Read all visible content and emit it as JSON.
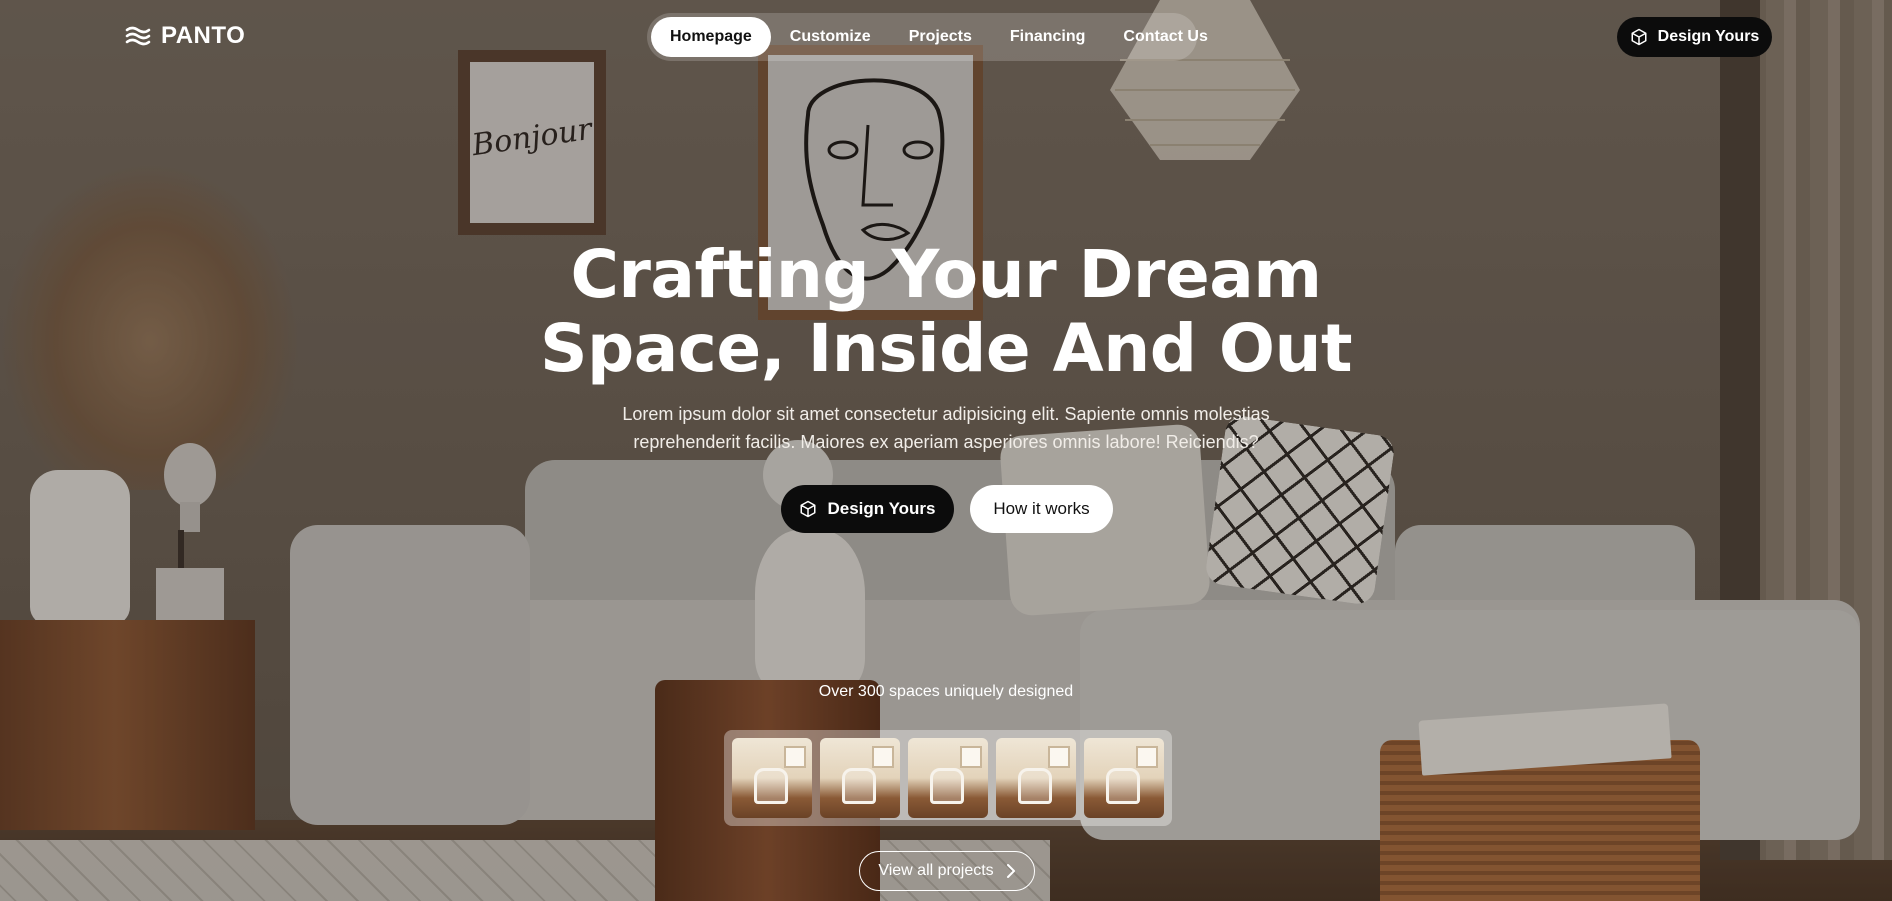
{
  "brand": {
    "name": "PANTO",
    "logo_icon": "waves-icon"
  },
  "nav": {
    "items": [
      {
        "label": "Homepage",
        "active": true
      },
      {
        "label": "Customize",
        "active": false
      },
      {
        "label": "Projects",
        "active": false
      },
      {
        "label": "Financing",
        "active": false
      },
      {
        "label": "Contact Us",
        "active": false
      }
    ],
    "cta_label": "Design Yours",
    "cta_icon": "cube-icon"
  },
  "hero": {
    "title_line1": "Crafting Your Dream",
    "title_line2": "Space, Inside And Out",
    "subtitle_line1": "Lorem ipsum dolor sit amet consectetur adipisicing elit. Sapiente omnis molestias",
    "subtitle_line2": "reprehenderit facilis. Maiores ex aperiam asperiores omnis labore! Reiciendis?",
    "primary_button": "Design Yours",
    "primary_icon": "cube-icon",
    "secondary_button": "How it works"
  },
  "projects": {
    "count_text": "Over 300 spaces uniquely designed",
    "thumbnail_count": 5,
    "view_all_label": "View all projects",
    "view_all_icon": "chevron-right-icon"
  },
  "colors": {
    "dark_button": "#0c0c0c",
    "light_button": "#ffffff",
    "text_on_dark": "#ffffff"
  }
}
